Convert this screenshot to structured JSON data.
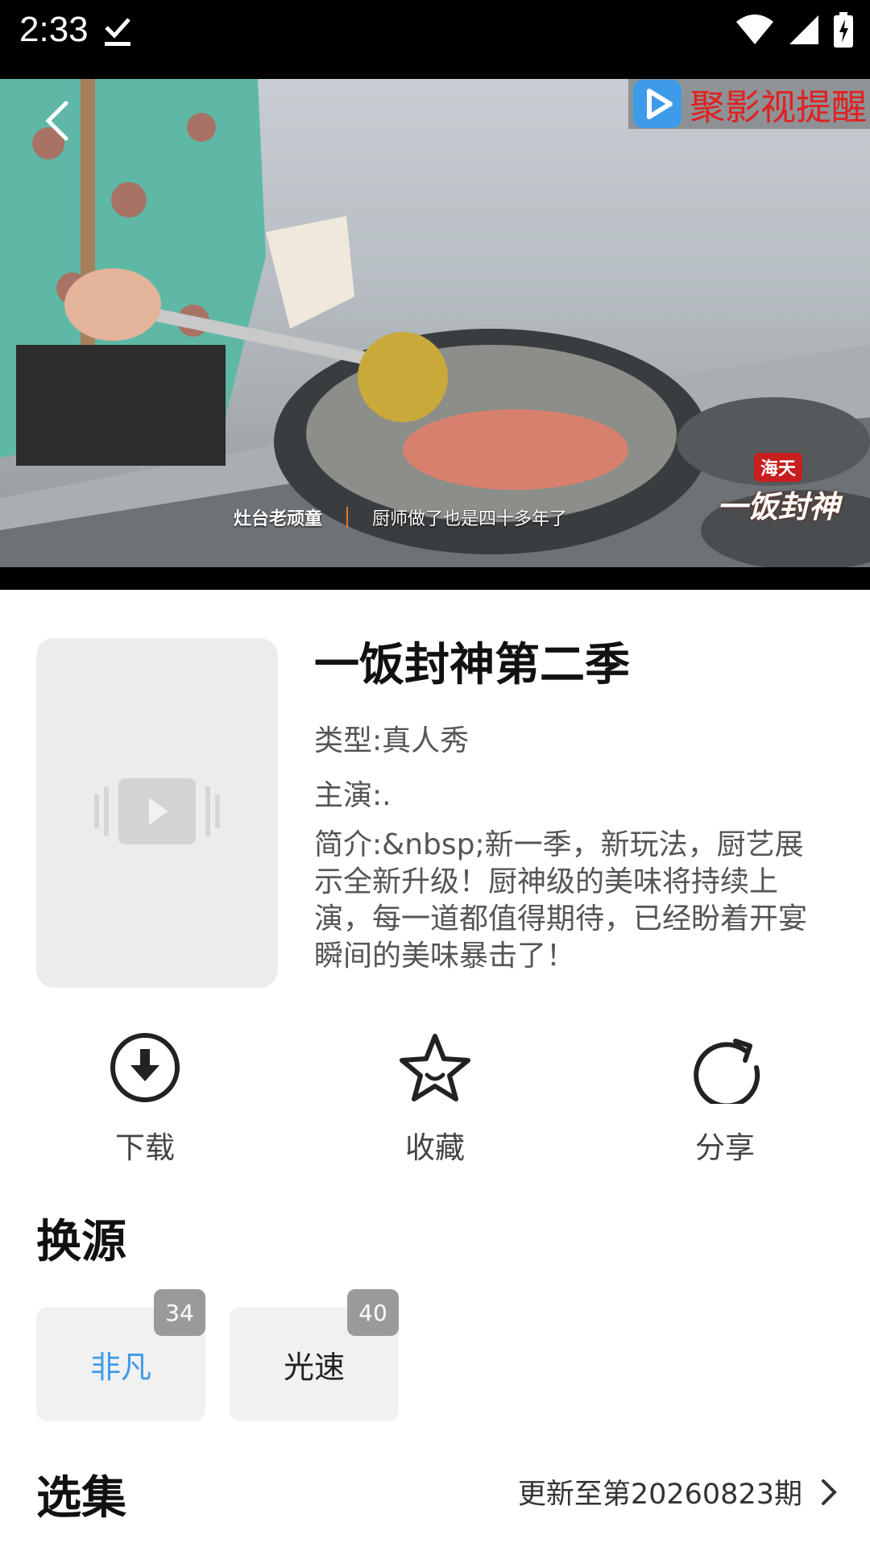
{
  "status": {
    "time": "2:33"
  },
  "player": {
    "watermark_text": "聚影视提醒",
    "subtitle_left": "灶台老顽童",
    "subtitle_right": "厨师做了也是四十多年了",
    "logo_top": "海天",
    "logo_bottom": "一饭封神"
  },
  "show": {
    "title": "一饭封神第二季",
    "type": "类型:真人秀",
    "cast": "主演:.",
    "desc": "简介:&nbsp;新一季，新玩法，厨艺展示全新升级！厨神级的美味将持续上演，每一道都值得期待，已经盼着开宴瞬间的美味暴击了！"
  },
  "actions": {
    "download": "下载",
    "favorite": "收藏",
    "share": "分享"
  },
  "sources": {
    "title": "换源",
    "items": [
      {
        "label": "非凡",
        "count": "34",
        "active": true
      },
      {
        "label": "光速",
        "count": "40",
        "active": false
      }
    ]
  },
  "episodes": {
    "title": "选集",
    "update": "更新至第20260823期"
  },
  "colors": {
    "accent": "#3d9be9",
    "watermark": "#e02020"
  }
}
